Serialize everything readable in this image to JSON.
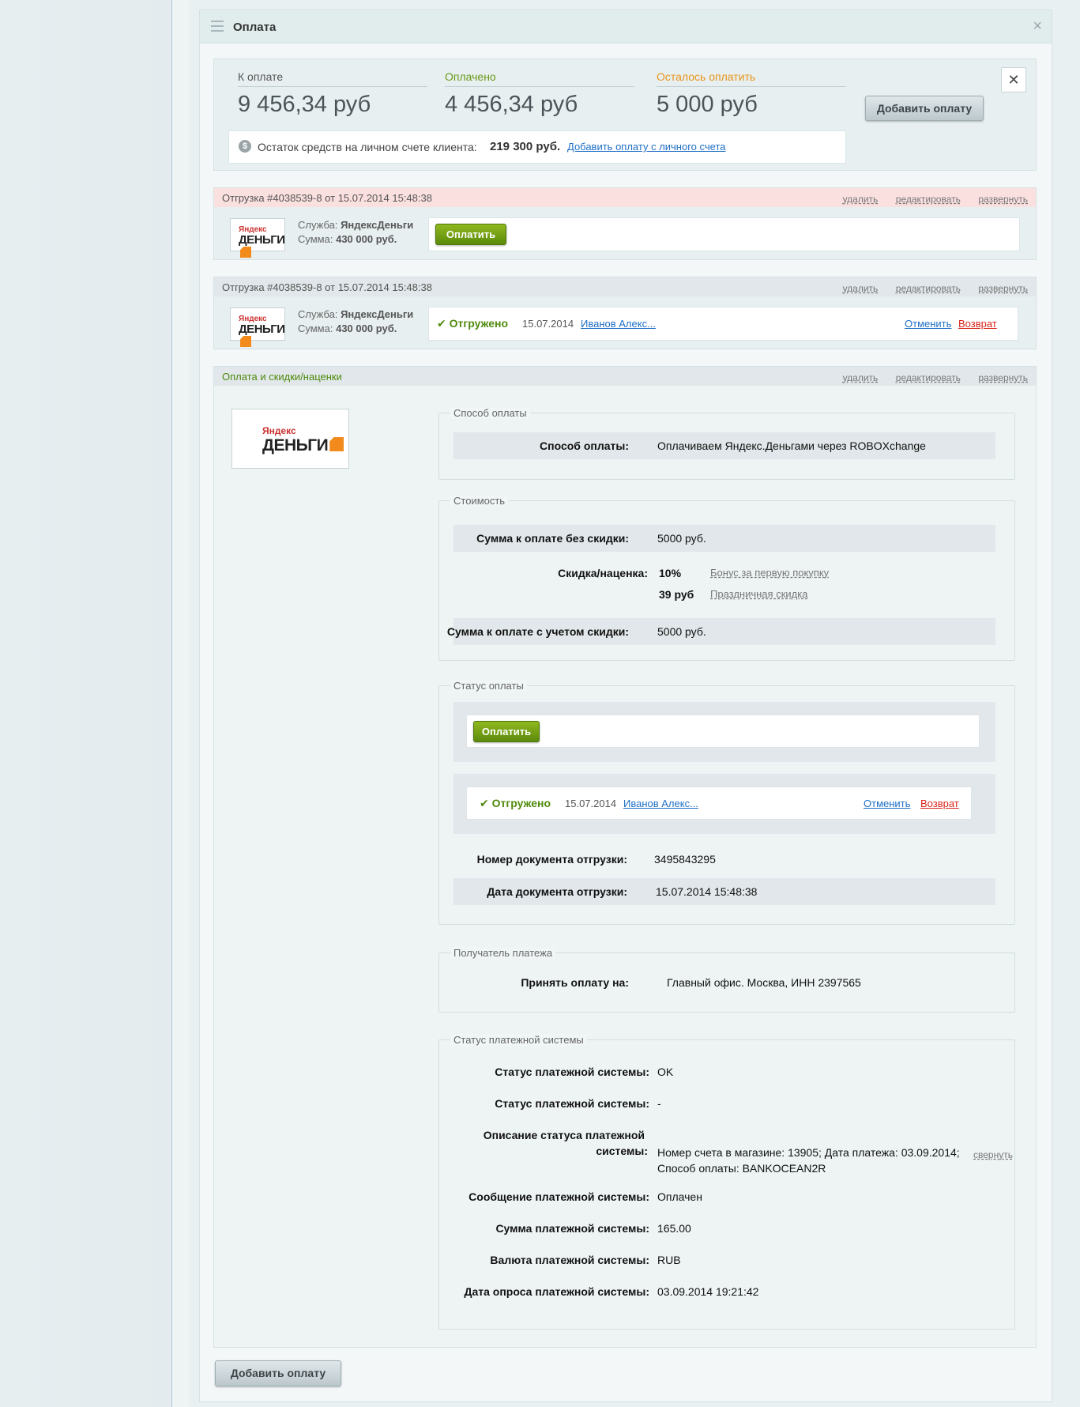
{
  "panel": {
    "title": "Оплата"
  },
  "summary": {
    "due_label": "К оплате",
    "due_value": "9 456,34 руб",
    "paid_label": "Оплачено",
    "paid_value": "4 456,34 руб",
    "left_label": "Осталось оплатить",
    "left_value": "5 000 руб",
    "add_payment": "Добавить оплату",
    "balance_text": "Остаток средств на личном счете клиента:",
    "balance_value": "219 300 руб.",
    "balance_link": "Добавить оплату с личного счета",
    "dollar": "$"
  },
  "actions": {
    "delete": "удалить",
    "edit": "редактировать",
    "expand": "развернуть",
    "collapse": "свернуть"
  },
  "logo": {
    "yandex": "Яндекс",
    "dengi": "ДЕНЬГИ"
  },
  "shipment1": {
    "title": "Отгрузка #4038539-8  от 15.07.2014 15:48:38",
    "service_label": "Служба:",
    "service": "ЯндексДеньги",
    "sum_label": "Сумма:",
    "sum": "430 000 руб.",
    "pay_button": "Оплатить"
  },
  "shipment2": {
    "title": "Отгрузка #4038539-8  от 15.07.2014 15:48:38",
    "service_label": "Служба:",
    "service": "ЯндексДеньги",
    "sum_label": "Сумма:",
    "sum": "430 000 руб.",
    "status": "Отгружено",
    "date": "15.07.2014",
    "user": "Иванов Алекс...",
    "cancel": "Отменить",
    "refund": "Возврат"
  },
  "payment": {
    "title": "Оплата и скидки/наценки",
    "method_legend": "Способ оплаты",
    "method_key": "Способ оплаты:",
    "method_value": "Оплачиваем Яндекс.Деньгами через ROBOXchange",
    "cost_legend": "Стоимость",
    "no_discount_key": "Сумма к оплате без скидки:",
    "no_discount_value": "5000 руб.",
    "discount_key": "Скидка/наценка:",
    "discount1": "10%",
    "discount1_link": "Бонус за первую покупку",
    "discount2": "39 руб",
    "discount2_link": "Праздничная скидка",
    "with_discount_key": "Сумма к оплате с учетом скидки:",
    "with_discount_value": "5000 руб.",
    "status_legend": "Статус оплаты",
    "pay_button": "Оплатить",
    "status": "Отгружено",
    "date": "15.07.2014",
    "user": "Иванов Алекс...",
    "cancel": "Отменить",
    "refund": "Возврат",
    "doc_num_key": "Номер документа отгрузки:",
    "doc_num_value": "3495843295",
    "doc_date_key": "Дата документа отгрузки:",
    "doc_date_value": "15.07.2014 15:48:38",
    "recipient_legend": "Получатель платежа",
    "recipient_key": "Принять оплату на:",
    "recipient_value": "Главный офис. Москва, ИНН 2397565",
    "ps_legend": "Статус платежной системы",
    "ps_status_key": "Статус платежной системы:",
    "ps_status_value": "OK",
    "ps_status2_key": "Статус платежной системы:",
    "ps_status2_value": "-",
    "ps_desc_key1": "Описание статуса платежной",
    "ps_desc_key2": "системы:",
    "ps_desc_value1": "Номер счета в магазине: 13905; Дата платежа: 03.09.2014;",
    "ps_desc_value2": "Способ оплаты: BANKOCEAN2R",
    "ps_msg_key": "Сообщение платежной системы:",
    "ps_msg_value": "Оплачен",
    "ps_sum_key": "Сумма платежной системы:",
    "ps_sum_value": "165.00",
    "ps_cur_key": "Валюта платежной системы:",
    "ps_cur_value": "RUB",
    "ps_date_key": "Дата опроса платежной системы:",
    "ps_date_value": "03.09.2014  19:21:42"
  },
  "footer": {
    "add_payment": "Добавить оплату"
  },
  "colors": {
    "green": "#5c8a0b",
    "paid": "#6a9a1a",
    "left": "#e8941a",
    "red_header": "#fbe0e0"
  }
}
